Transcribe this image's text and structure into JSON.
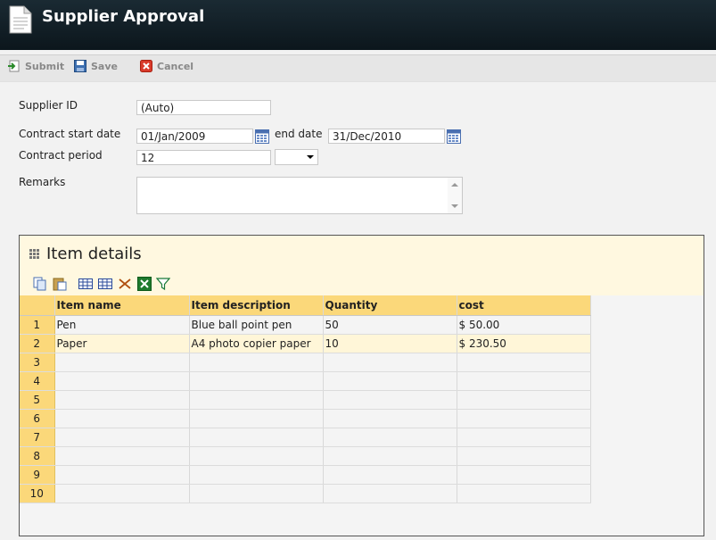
{
  "header": {
    "title": "Supplier Approval",
    "icon": "document-icon"
  },
  "toolbar": {
    "submit_label": "Submit",
    "save_label": "Save",
    "cancel_label": "Cancel"
  },
  "form": {
    "supplier_id_label": "Supplier ID",
    "supplier_id_value": "(Auto)",
    "contract_start_label": "Contract start date",
    "contract_start_value": "01/Jan/2009",
    "end_date_label": "end date",
    "end_date_value": "31/Dec/2010",
    "contract_period_label": "Contract period",
    "contract_period_value": "12",
    "contract_period_unit": "",
    "remarks_label": "Remarks",
    "remarks_value": ""
  },
  "item_panel": {
    "title": "Item details",
    "columns": [
      "Item name",
      "Item description",
      "Quantity",
      "cost"
    ],
    "rows": [
      {
        "num": "1",
        "cells": [
          "Pen",
          "Blue ball point pen",
          "50",
          "$ 50.00"
        ]
      },
      {
        "num": "2",
        "cells": [
          "Paper",
          "A4 photo copier paper",
          "10",
          "$ 230.50"
        ]
      },
      {
        "num": "3",
        "cells": [
          "",
          "",
          "",
          ""
        ]
      },
      {
        "num": "4",
        "cells": [
          "",
          "",
          "",
          ""
        ]
      },
      {
        "num": "5",
        "cells": [
          "",
          "",
          "",
          ""
        ]
      },
      {
        "num": "6",
        "cells": [
          "",
          "",
          "",
          ""
        ]
      },
      {
        "num": "7",
        "cells": [
          "",
          "",
          "",
          ""
        ]
      },
      {
        "num": "8",
        "cells": [
          "",
          "",
          "",
          ""
        ]
      },
      {
        "num": "9",
        "cells": [
          "",
          "",
          "",
          ""
        ]
      },
      {
        "num": "10",
        "cells": [
          "",
          "",
          "",
          ""
        ]
      }
    ]
  },
  "colors": {
    "header_bg": "#0c161c",
    "grid_header": "#fbd87a",
    "panel_bg": "#fff8e0"
  }
}
